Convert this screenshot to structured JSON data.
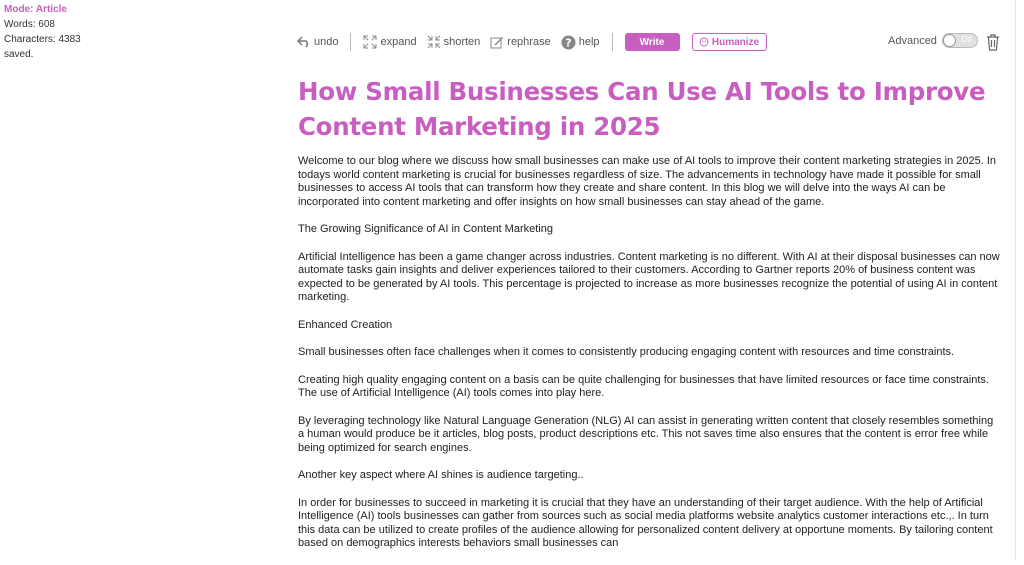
{
  "status": {
    "mode": "Mode: Article",
    "words": "Words: 608",
    "characters": "Characters: 4383",
    "saved": "saved."
  },
  "toolbar": {
    "undo": "undo",
    "expand": "expand",
    "shorten": "shorten",
    "rephrase": "rephrase",
    "help": "help",
    "write": "Write",
    "humanize": "Humanize",
    "advanced": "Advanced",
    "toggle_state": "Off"
  },
  "colors": {
    "accent": "#c85fc0"
  },
  "icons": [
    "undo-icon",
    "expand-icon",
    "shorten-icon",
    "rephrase-icon",
    "help-icon",
    "humanize-icon",
    "trash-icon"
  ],
  "article": {
    "title": "How Small Businesses Can Use AI Tools to Improve Content Marketing in 2025",
    "paragraphs": [
      "Welcome to our blog where we discuss how small businesses can make use of AI tools to improve their content marketing strategies in 2025. In todays world content marketing is crucial for businesses regardless of size. The advancements in technology have made it possible for small businesses to access AI tools that can transform how they create and share content. In this blog we will delve into the ways AI can be incorporated into content marketing and offer insights on how small businesses can stay ahead of the game.",
      "The Growing Significance of AI in Content Marketing",
      "Artificial Intelligence has been a game changer across industries. Content marketing is no different. With AI at their disposal businesses can now automate tasks gain insights and deliver experiences tailored to their customers. According to Gartner reports 20% of business content was expected to be generated by AI tools. This percentage is projected to increase as more businesses recognize the potential of using AI in content marketing.",
      "Enhanced Creation",
      "Small businesses often face challenges when it comes to consistently producing engaging content with resources and time constraints.",
      "Creating high quality engaging content on a basis can be quite challenging for businesses that have limited resources or face time constraints. The use of Artificial Intelligence (AI) tools comes into play here.",
      "By leveraging technology like Natural Language Generation (NLG) AI can assist in generating written content that closely resembles something a human would produce be it articles, blog posts, product descriptions etc. This not saves time also ensures that the content is error free while being optimized for search engines.",
      "Another key aspect where AI shines is audience targeting..",
      "In order for businesses to succeed in marketing it is crucial that they have an understanding of their target audience. With the help of Artificial Intelligence (AI) tools businesses can gather from sources such as social media platforms website analytics customer interactions etc.,. In turn this data can be utilized to create profiles of the audience allowing for personalized content delivery at opportune moments. By tailoring content based on demographics interests behaviors small businesses can"
    ]
  }
}
